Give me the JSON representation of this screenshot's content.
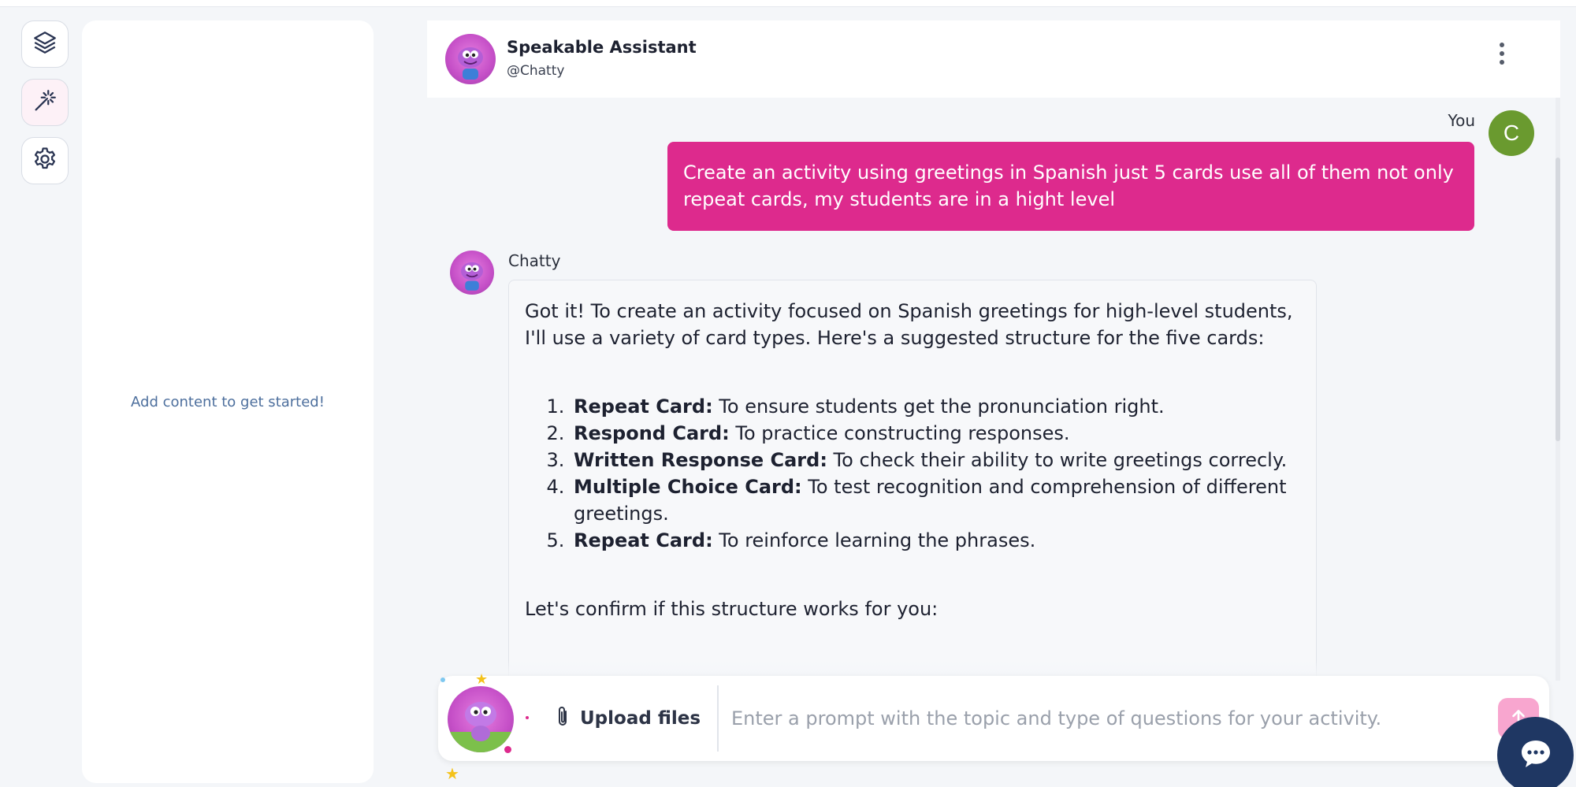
{
  "sidebar_rail": {
    "items": [
      {
        "icon": "layers-icon"
      },
      {
        "icon": "magic-wand-icon"
      },
      {
        "icon": "gear-icon"
      }
    ]
  },
  "content_panel": {
    "empty_text": "Add content to get started!"
  },
  "chat_header": {
    "name": "Speakable Assistant",
    "handle": "@Chatty"
  },
  "messages": {
    "user": {
      "label": "You",
      "avatar_letter": "C",
      "avatar_color": "#6a9a2f",
      "text": "Create an activity using greetings in Spanish just 5 cards use all of them not only repeat cards, my students are in a hight level"
    },
    "assistant": {
      "name": "Chatty",
      "intro": "Got it! To create an activity focused on Spanish greetings for high-level students, I'll use a variety of card types. Here's a suggested structure for the five cards:",
      "items": [
        {
          "title": "Repeat Card:",
          "text": " To ensure students get the pronunciation right."
        },
        {
          "title": "Respond Card:",
          "text": " To practice constructing responses."
        },
        {
          "title": "Written Response Card:",
          "text": " To check their ability to write greetings correcly."
        },
        {
          "title": "Multiple Choice Card:",
          "text": " To test recognition and comprehension of different greetings."
        },
        {
          "title": "Repeat Card:",
          "text": " To reinforce learning the phrases."
        }
      ],
      "outro": "Let's confirm if this structure works for you:"
    }
  },
  "composer": {
    "upload_label": "Upload files",
    "placeholder": "Enter a prompt with the topic and type of questions for your activity."
  },
  "colors": {
    "accent": "#dd2a8d",
    "help_button": "#1f3763",
    "send_button": "#f8a6cf"
  }
}
